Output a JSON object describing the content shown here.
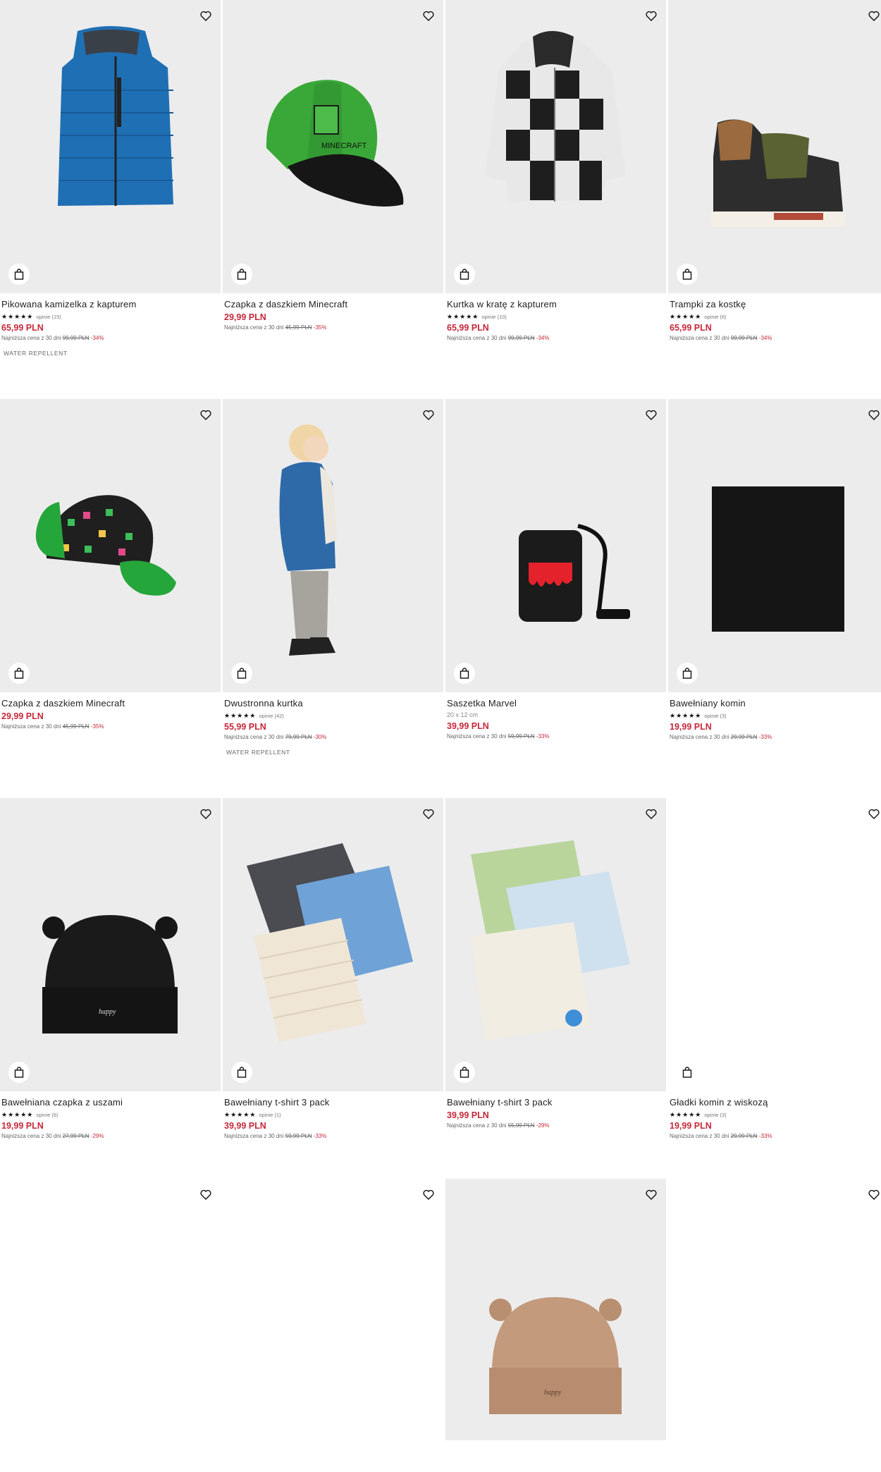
{
  "products": [
    {
      "name": "Pikowana kamizelka z kapturem",
      "stars": "★★★★★",
      "reviews": "opinie (15)",
      "subtitle": "",
      "price": "65,99 PLN",
      "lowest_label": "Najniższa cena z 30 dni",
      "lowest_old": "99,99 PLN",
      "lowest_disc": "-34%",
      "tag": "WATER REPELLENT"
    },
    {
      "name": "Czapka z daszkiem Minecraft",
      "stars": "",
      "reviews": "",
      "subtitle": "",
      "price": "29,99 PLN",
      "lowest_label": "Najniższa cena z 30 dni",
      "lowest_old": "45,99 PLN",
      "lowest_disc": "-35%",
      "tag": ""
    },
    {
      "name": "Kurtka w kratę z kapturem",
      "stars": "★★★★★",
      "reviews": "opinie (10)",
      "subtitle": "",
      "price": "65,99 PLN",
      "lowest_label": "Najniższa cena z 30 dni",
      "lowest_old": "99,99 PLN",
      "lowest_disc": "-34%",
      "tag": ""
    },
    {
      "name": "Trampki za kostkę",
      "stars": "★★★★★",
      "reviews": "opinie (6)",
      "subtitle": "",
      "price": "65,99 PLN",
      "lowest_label": "Najniższa cena z 30 dni",
      "lowest_old": "99,99 PLN",
      "lowest_disc": "-34%",
      "tag": ""
    },
    {
      "name": "Czapka z daszkiem Minecraft",
      "stars": "",
      "reviews": "",
      "subtitle": "",
      "price": "29,99 PLN",
      "lowest_label": "Najniższa cena z 30 dni",
      "lowest_old": "45,99 PLN",
      "lowest_disc": "-35%",
      "tag": ""
    },
    {
      "name": "Dwustronna kurtka",
      "stars": "★★★★★",
      "reviews": "opinie (42)",
      "subtitle": "",
      "price": "55,99 PLN",
      "lowest_label": "Najniższa cena z 30 dni",
      "lowest_old": "79,99 PLN",
      "lowest_disc": "-30%",
      "tag": "WATER REPELLENT"
    },
    {
      "name": "Saszetka Marvel",
      "stars": "",
      "reviews": "",
      "subtitle": "20 x 12 cm",
      "price": "39,99 PLN",
      "lowest_label": "Najniższa cena z 30 dni",
      "lowest_old": "59,99 PLN",
      "lowest_disc": "-33%",
      "tag": ""
    },
    {
      "name": "Bawełniany komin",
      "stars": "★★★★★",
      "reviews": "opinie (3)",
      "subtitle": "",
      "price": "19,99 PLN",
      "lowest_label": "Najniższa cena z 30 dni",
      "lowest_old": "29,99 PLN",
      "lowest_disc": "-33%",
      "tag": ""
    },
    {
      "name": "Bawełniana czapka z uszami",
      "stars": "★★★★★",
      "reviews": "opinie (6)",
      "subtitle": "",
      "price": "19,99 PLN",
      "lowest_label": "Najniższa cena z 30 dni",
      "lowest_old": "27,99 PLN",
      "lowest_disc": "-29%",
      "tag": ""
    },
    {
      "name": "Bawełniany t-shirt 3 pack",
      "stars": "★★★★★",
      "reviews": "opinie (1)",
      "subtitle": "",
      "price": "39,99 PLN",
      "lowest_label": "Najniższa cena z 30 dni",
      "lowest_old": "59,99 PLN",
      "lowest_disc": "-33%",
      "tag": ""
    },
    {
      "name": "Bawełniany t-shirt 3 pack",
      "stars": "",
      "reviews": "",
      "subtitle": "",
      "price": "39,99 PLN",
      "lowest_label": "Najniższa cena z 30 dni",
      "lowest_old": "55,99 PLN",
      "lowest_disc": "-29%",
      "tag": ""
    },
    {
      "name": "Gładki komin z wiskozą",
      "stars": "★★★★★",
      "reviews": "opinie (3)",
      "subtitle": "",
      "price": "19,99 PLN",
      "lowest_label": "Najniższa cena z 30 dni",
      "lowest_old": "29,99 PLN",
      "lowest_disc": "-33%",
      "tag": ""
    }
  ],
  "icons": {
    "favorite": "heart-outline-icon",
    "add_to_cart": "shopping-bag-icon"
  },
  "colors": {
    "price": "#c6283a",
    "tile_bg": "#ececec"
  }
}
